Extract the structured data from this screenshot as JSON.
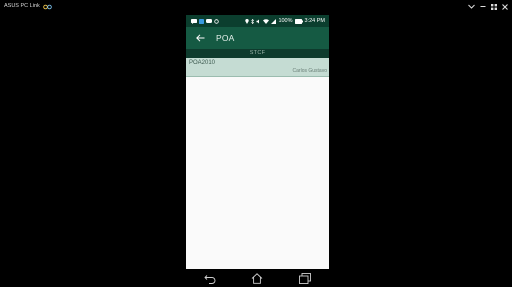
{
  "host": {
    "title": "ASUS PC Link"
  },
  "statusbar": {
    "battery": "100%",
    "time": "3:24 PM"
  },
  "appbar": {
    "title": "POA"
  },
  "section": {
    "header": "STCF"
  },
  "list": {
    "items": [
      {
        "code": "POA2010",
        "name": "Carlos Gustavo"
      }
    ]
  },
  "colors": {
    "statusbar": "#0b3e2e",
    "appbar": "#155a43",
    "section_header": "#0e3b2d",
    "list_item_bg": "#c5dcd3",
    "content_bg": "#fafafa"
  }
}
